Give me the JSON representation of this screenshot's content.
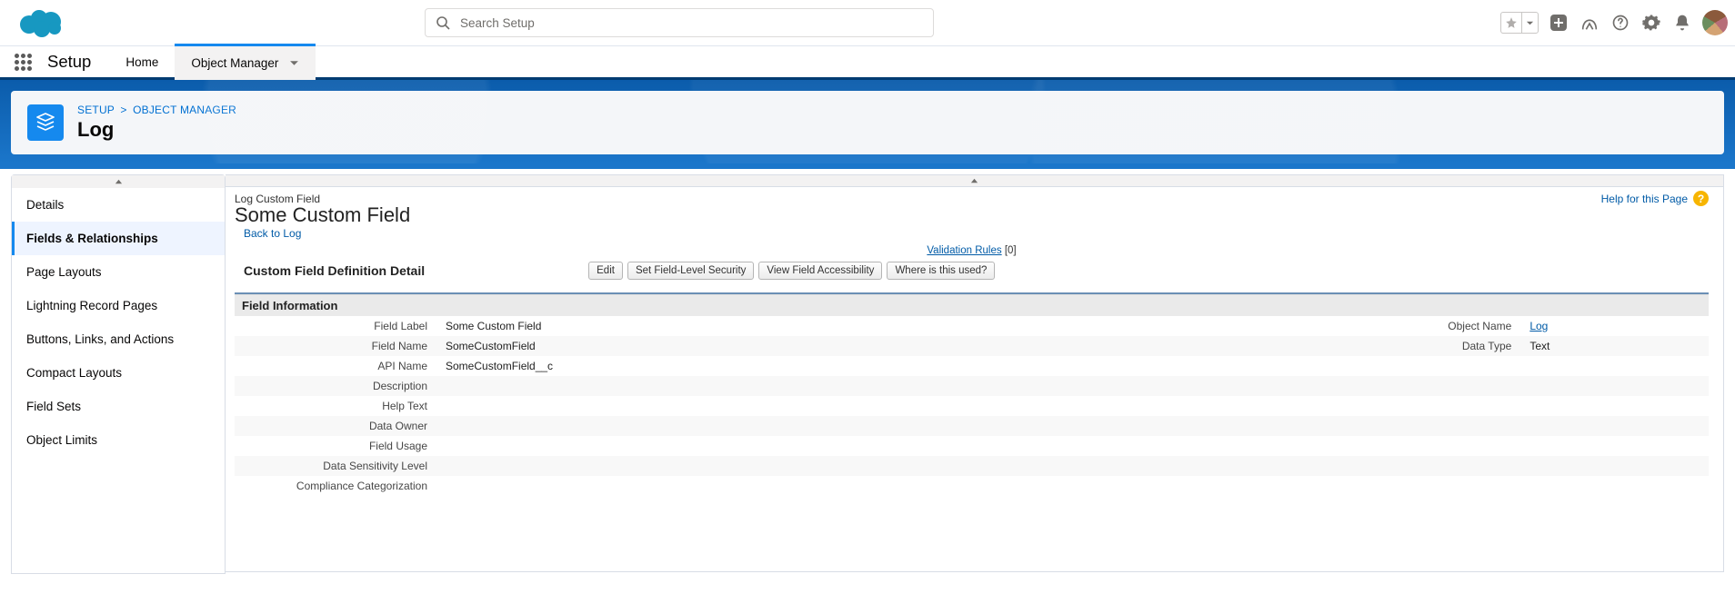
{
  "header": {
    "search_placeholder": "Search Setup"
  },
  "tabs": {
    "app_name": "Setup",
    "home": "Home",
    "object_manager": "Object Manager"
  },
  "breadcrumb": {
    "setup": "SETUP",
    "objmgr": "OBJECT MANAGER",
    "title": "Log"
  },
  "sidebar": {
    "items": [
      {
        "label": "Details"
      },
      {
        "label": "Fields & Relationships",
        "active": true
      },
      {
        "label": "Page Layouts"
      },
      {
        "label": "Lightning Record Pages"
      },
      {
        "label": "Buttons, Links, and Actions"
      },
      {
        "label": "Compact Layouts"
      },
      {
        "label": "Field Sets"
      },
      {
        "label": "Object Limits"
      }
    ]
  },
  "detail": {
    "pretitle": "Log Custom Field",
    "title": "Some Custom Field",
    "back_to": "Back to Log",
    "help_for_page": "Help for this Page",
    "validation_rules_label": "Validation Rules",
    "validation_rules_count": "[0]",
    "definition_title": "Custom Field Definition Detail",
    "buttons": {
      "edit": "Edit",
      "fls": "Set Field-Level Security",
      "vfa": "View Field Accessibility",
      "where": "Where is this used?"
    },
    "section_field_info": "Field Information",
    "labels": {
      "field_label": "Field Label",
      "field_name": "Field Name",
      "api_name": "API Name",
      "description": "Description",
      "help_text": "Help Text",
      "data_owner": "Data Owner",
      "field_usage": "Field Usage",
      "data_sensitivity": "Data Sensitivity Level",
      "compliance": "Compliance Categorization",
      "object_name": "Object Name",
      "data_type": "Data Type"
    },
    "values": {
      "field_label": "Some Custom Field",
      "field_name": "SomeCustomField",
      "api_name": "SomeCustomField__c",
      "description": "",
      "help_text": "",
      "data_owner": "",
      "field_usage": "",
      "data_sensitivity": "",
      "compliance": "",
      "object_name": "Log",
      "data_type": "Text"
    }
  }
}
